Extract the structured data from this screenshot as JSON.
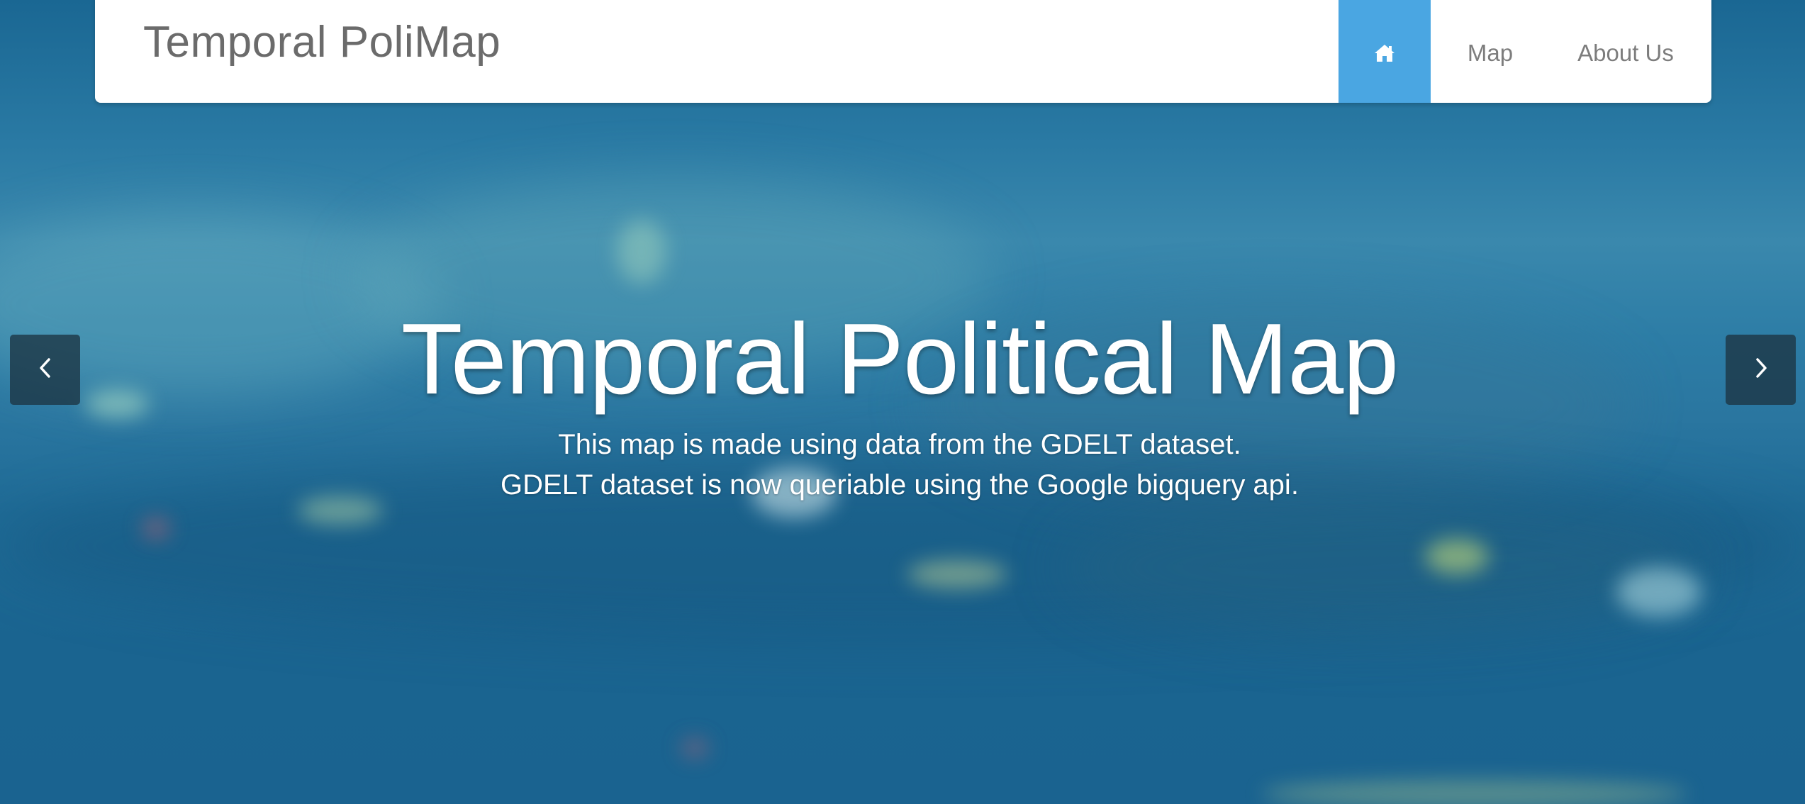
{
  "navbar": {
    "brand": "Temporal PoliMap",
    "items": [
      {
        "label": "",
        "icon": "home-icon",
        "active": true
      },
      {
        "label": "Map",
        "active": false
      },
      {
        "label": "About Us",
        "active": false
      }
    ]
  },
  "hero": {
    "title": "Temporal Political Map",
    "lines": [
      "This map is made using data from the GDELT dataset.",
      "GDELT dataset is now queriable using the Google bigquery api."
    ]
  },
  "carousel": {
    "prev_icon": "chevron-left-icon",
    "next_icon": "chevron-right-icon"
  },
  "colors": {
    "accent": "#4aa6e2",
    "background": "#1f6a93",
    "nav_text": "#7d7d7d",
    "brand_text": "#6b6b6b"
  }
}
